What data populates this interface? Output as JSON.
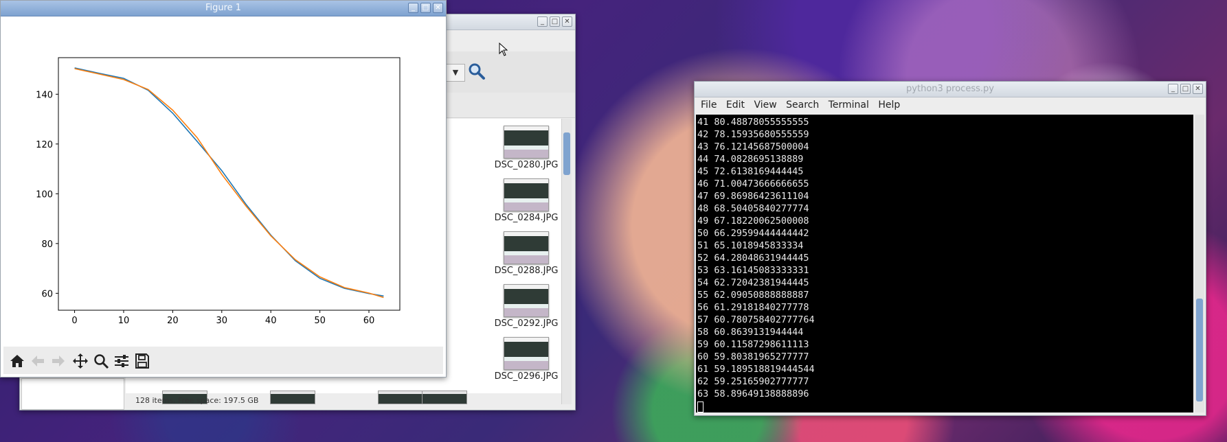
{
  "file_manager": {
    "status": "128 items, Free space: 197.5 GB",
    "files": [
      "DSC_0280.JPG",
      "DSC_0284.JPG",
      "DSC_0288.JPG",
      "DSC_0292.JPG",
      "DSC_0296.JPG"
    ]
  },
  "figure": {
    "title": "Figure 1",
    "chart_data": {
      "type": "line",
      "x_ticks": [
        0,
        10,
        20,
        30,
        40,
        50,
        60
      ],
      "y_ticks": [
        60,
        80,
        100,
        120,
        140
      ],
      "xlim": [
        -3.3,
        66.3
      ],
      "ylim": [
        53.2,
        154.7
      ],
      "series": [
        {
          "color": "#1f77b4",
          "x": [
            0,
            5,
            10,
            15,
            20,
            25,
            30,
            35,
            40,
            45,
            50,
            55,
            60,
            63
          ],
          "y": [
            150.6,
            148.4,
            146.4,
            141.6,
            132.4,
            121.0,
            109.3,
            95.6,
            83.4,
            73.1,
            66.0,
            62.0,
            59.9,
            58.9
          ]
        },
        {
          "color": "#ff7f0e",
          "x": [
            0,
            5,
            10,
            15,
            20,
            25,
            30,
            35,
            40,
            45,
            50,
            55,
            60,
            63
          ],
          "y": [
            150.3,
            148.1,
            145.9,
            141.9,
            133.6,
            122.5,
            107.8,
            94.9,
            83.1,
            73.5,
            66.6,
            62.3,
            60.1,
            58.3
          ]
        }
      ]
    }
  },
  "terminal": {
    "title": "python3 process.py",
    "menu": [
      "File",
      "Edit",
      "View",
      "Search",
      "Terminal",
      "Help"
    ],
    "lines": [
      "41 80.48878055555555",
      "42 78.15935680555559",
      "43 76.12145687500004",
      "44 74.0828695138889",
      "45 72.6138169444445",
      "46 71.00473666666655",
      "47 69.86986423611104",
      "48 68.50405840277774",
      "49 67.18220062500008",
      "50 66.29599444444442",
      "51 65.1018945833334",
      "52 64.28048631944445",
      "53 63.16145083333331",
      "54 62.72042381944445",
      "55 62.09050888888887",
      "56 61.29181840277778",
      "57 60.780758402777764",
      "58 60.8639131944444",
      "59 60.11587298611113",
      "60 59.80381965277777",
      "61 59.189518819444544",
      "62 59.25165902777777",
      "63 58.89649138888896"
    ]
  }
}
